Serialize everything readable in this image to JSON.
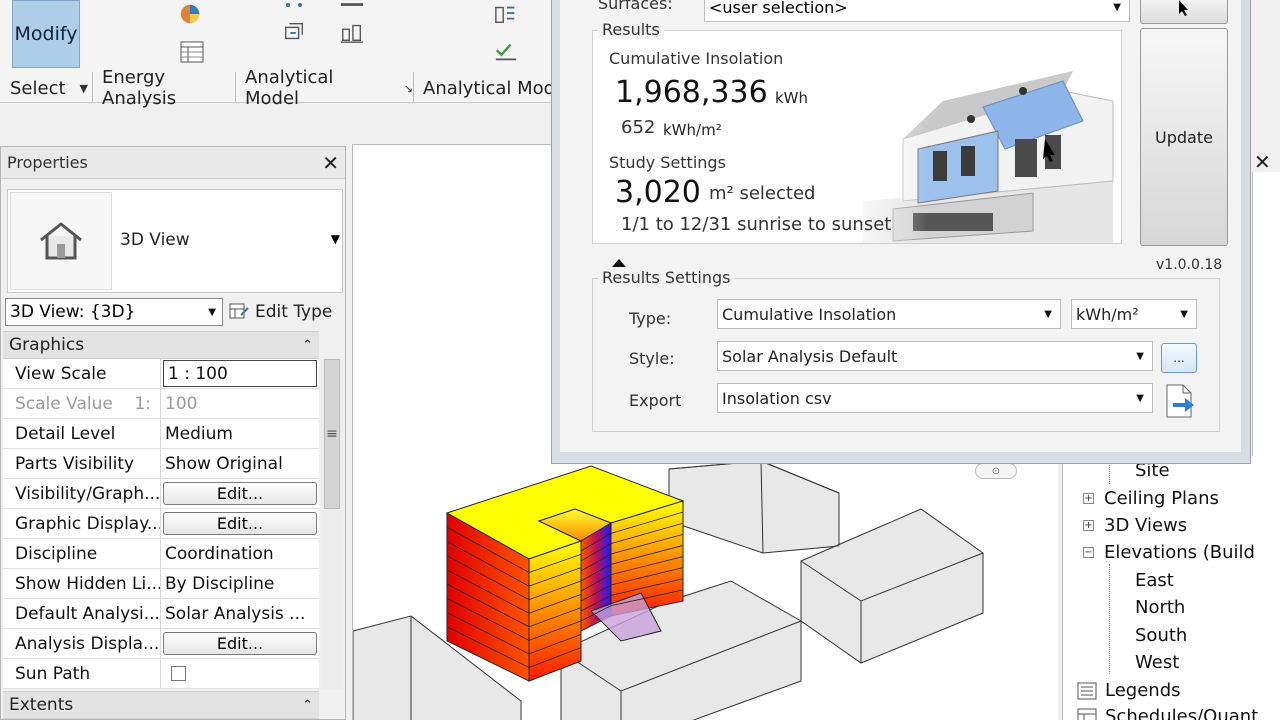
{
  "ribbon": {
    "modify_label": "Modify",
    "panels": [
      {
        "label": "Select",
        "has_arrow": true
      },
      {
        "label": "Energy Analysis"
      },
      {
        "label": "Analytical Model"
      },
      {
        "label": "Analytical Mode"
      }
    ],
    "select_label": "Select",
    "energy_label": "Energy Analysis",
    "analytical_label": "Analytical Model",
    "analytical2_label": "Analytical Mode"
  },
  "properties": {
    "title": "Properties",
    "type_name": "3D View",
    "view_selector": "3D View: {3D}",
    "edit_type": "Edit Type",
    "graphics_section": "Graphics",
    "extents_section": "Extents",
    "rows": [
      {
        "name": "View Scale",
        "value": "1 : 100"
      },
      {
        "name": "Scale Value    1:",
        "value": "100"
      },
      {
        "name": "Detail Level",
        "value": "Medium"
      },
      {
        "name": "Parts Visibility",
        "value": "Show Original"
      },
      {
        "name": "Visibility/Graph...",
        "value": "Edit..."
      },
      {
        "name": "Graphic Display...",
        "value": "Edit..."
      },
      {
        "name": "Discipline",
        "value": "Coordination"
      },
      {
        "name": "Show Hidden Li...",
        "value": "By Discipline"
      },
      {
        "name": "Default Analysi...",
        "value": "Solar Analysis ..."
      },
      {
        "name": "Analysis Displa...",
        "value": "Edit..."
      },
      {
        "name": "Sun Path",
        "value": ""
      }
    ]
  },
  "solar": {
    "surfaces_label": "Surfaces:",
    "surfaces_value": "<user selection>",
    "results_title": "Results",
    "cumulative_label": "Cumulative Insolation",
    "cumulative_value": "1,968,336",
    "cumulative_unit": "kWh",
    "per_area_value": "652",
    "per_area_unit": "kWh/m²",
    "study_label": "Study Settings",
    "area_value": "3,020",
    "area_unit": "m² selected",
    "date_range": "1/1 to 12/31 sunrise to sunset",
    "update_label": "Update",
    "version": "v1.0.0.18",
    "settings_title": "Results Settings",
    "type_label": "Type:",
    "type_value": "Cumulative Insolation",
    "type_unit": "kWh/m²",
    "style_label": "Style:",
    "style_value": "Solar Analysis Default",
    "style_btn": "...",
    "export_label": "Export",
    "export_value": "Insolation csv"
  },
  "browser": {
    "items": [
      {
        "label": "Site",
        "level": 2,
        "toggle": ""
      },
      {
        "label": "Ceiling Plans",
        "level": 1,
        "toggle": "+"
      },
      {
        "label": "3D Views",
        "level": 1,
        "toggle": "+"
      },
      {
        "label": "Elevations (Build",
        "level": 1,
        "toggle": "-"
      },
      {
        "label": "East",
        "level": 2,
        "toggle": ""
      },
      {
        "label": "North",
        "level": 2,
        "toggle": ""
      },
      {
        "label": "South",
        "level": 2,
        "toggle": ""
      },
      {
        "label": "West",
        "level": 2,
        "toggle": ""
      },
      {
        "label": "Legends",
        "level": 0,
        "toggle": ""
      },
      {
        "label": "Schedules/Quant",
        "level": 0,
        "toggle": ""
      }
    ]
  },
  "colors": {
    "modify_bg": "#aecde6",
    "heat_high": "#ffff00",
    "heat_mid": "#ff3300",
    "heat_low": "#2020ff"
  }
}
